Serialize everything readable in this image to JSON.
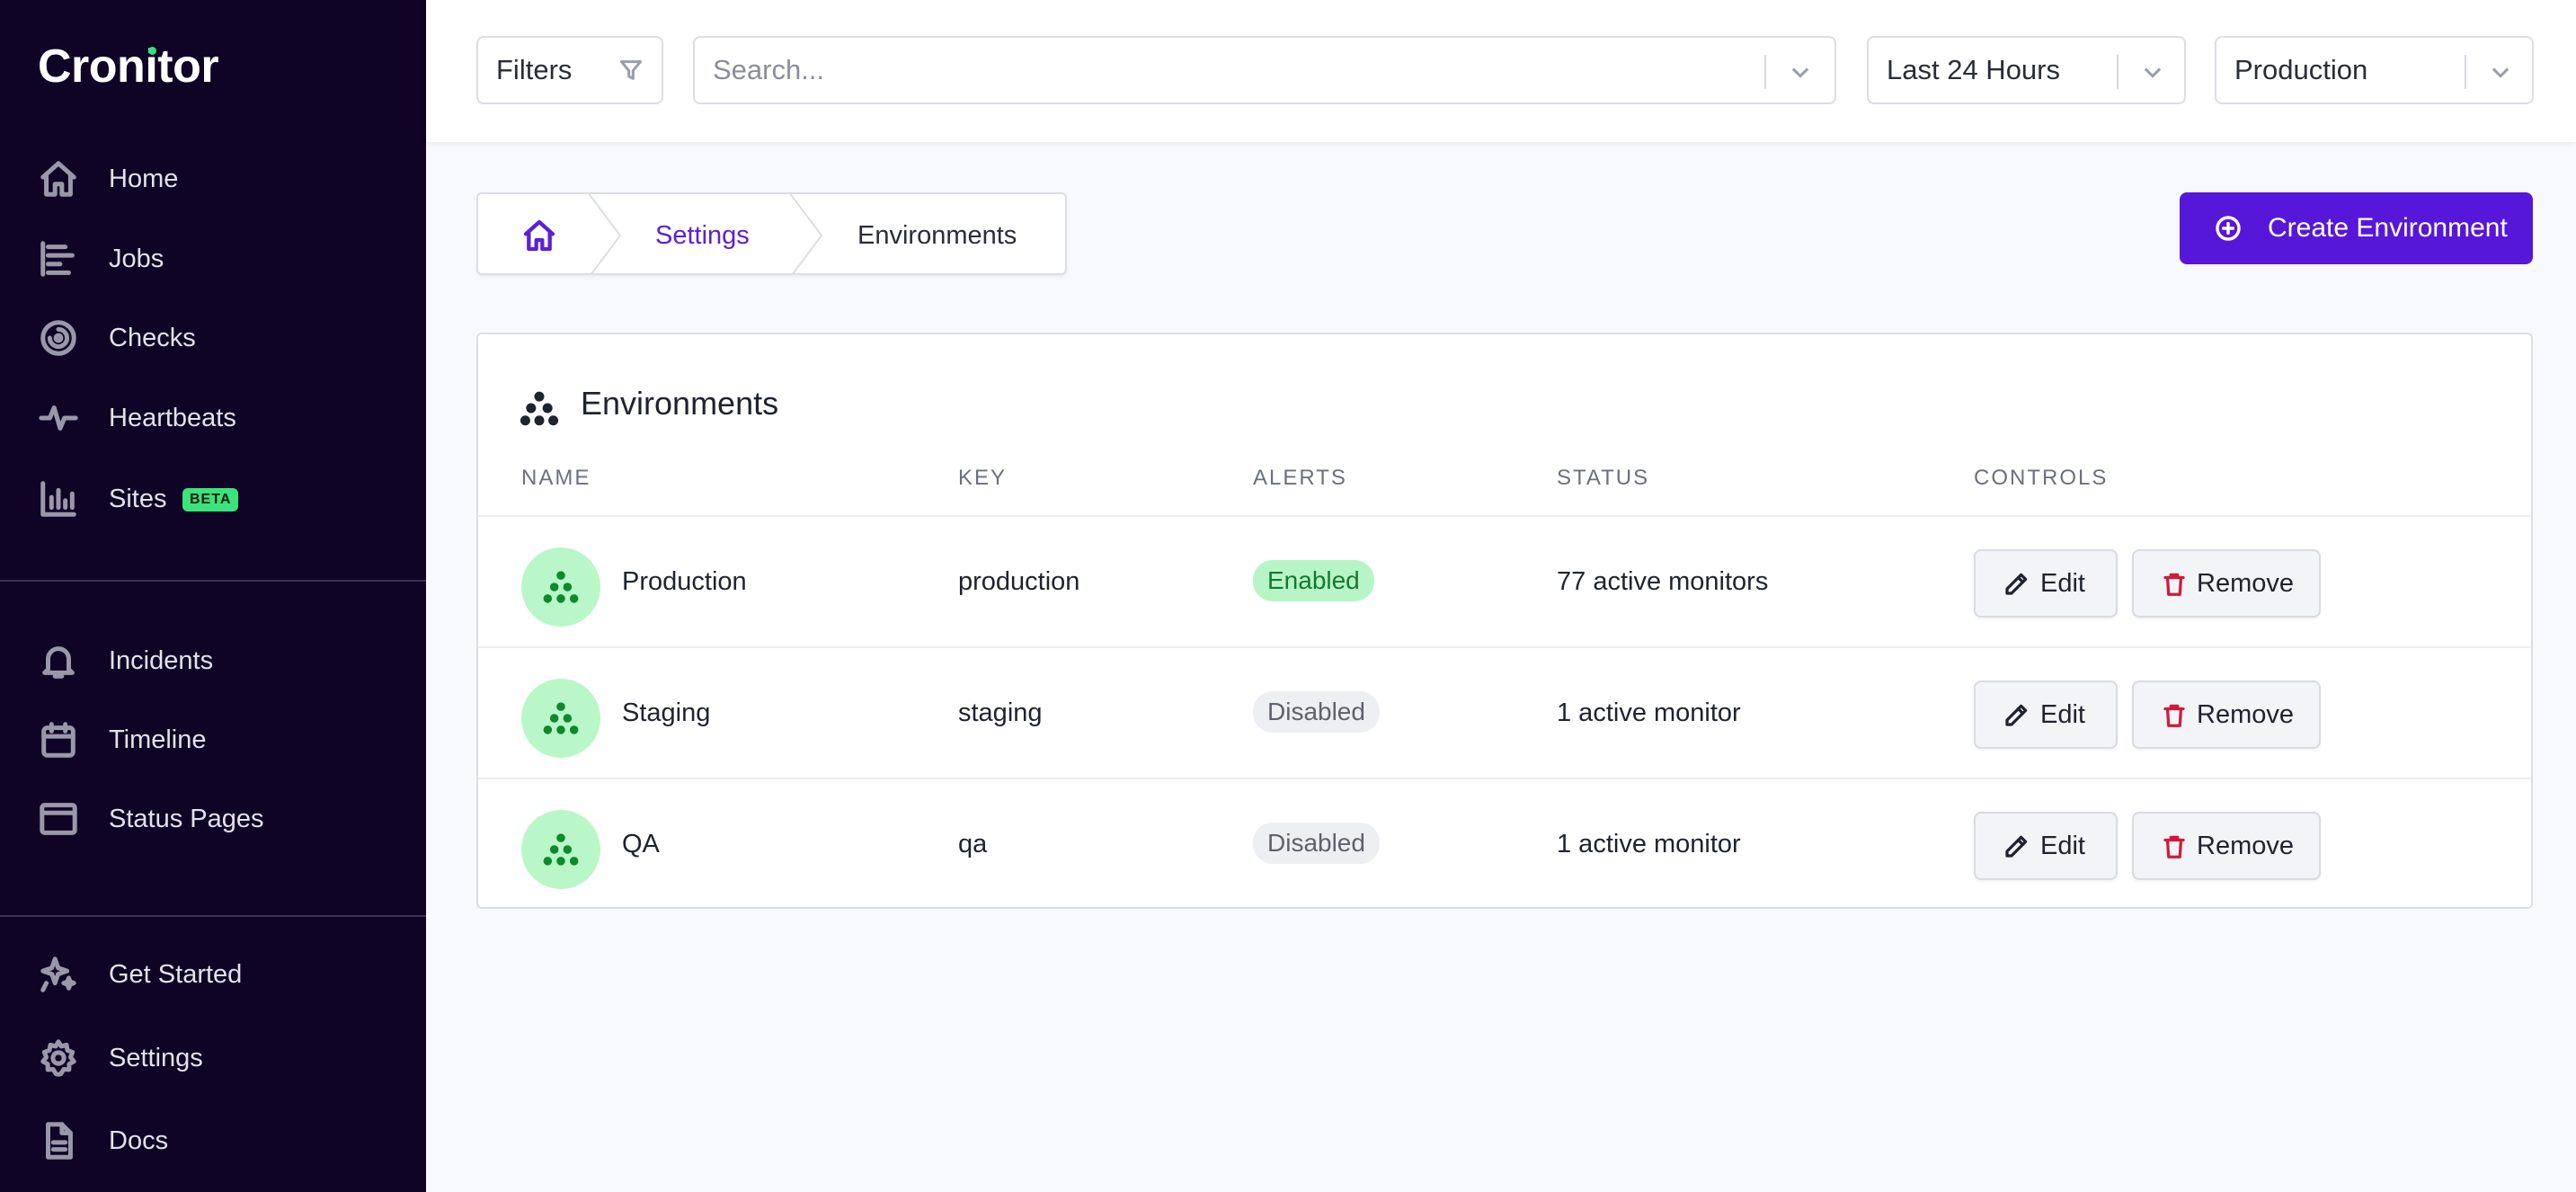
{
  "app": {
    "name": "Cronitor"
  },
  "sidebar": {
    "primary": [
      {
        "label": "Home",
        "icon": "home-icon"
      },
      {
        "label": "Jobs",
        "icon": "jobs-icon"
      },
      {
        "label": "Checks",
        "icon": "checks-icon"
      },
      {
        "label": "Heartbeats",
        "icon": "heartbeat-icon"
      },
      {
        "label": "Sites",
        "icon": "chart-bar-icon",
        "badge": "BETA"
      }
    ],
    "secondary": [
      {
        "label": "Incidents",
        "icon": "bell-icon"
      },
      {
        "label": "Timeline",
        "icon": "calendar-icon"
      },
      {
        "label": "Status Pages",
        "icon": "browser-window-icon"
      }
    ],
    "footer": [
      {
        "label": "Get Started",
        "icon": "sparkles-icon"
      },
      {
        "label": "Settings",
        "icon": "gear-icon"
      },
      {
        "label": "Docs",
        "icon": "document-icon"
      }
    ]
  },
  "topbar": {
    "filters_label": "Filters",
    "search_placeholder": "Search...",
    "time_range": "Last 24 Hours",
    "environment": "Production"
  },
  "breadcrumb": {
    "settings": "Settings",
    "current": "Environments"
  },
  "create_button": "Create Environment",
  "card": {
    "title": "Environments",
    "columns": [
      "NAME",
      "KEY",
      "ALERTS",
      "STATUS",
      "CONTROLS"
    ],
    "rows": [
      {
        "name": "Production",
        "key": "production",
        "alerts": "Enabled",
        "status": "77 active monitors"
      },
      {
        "name": "Staging",
        "key": "staging",
        "alerts": "Disabled",
        "status": "1 active monitor"
      },
      {
        "name": "QA",
        "key": "qa",
        "alerts": "Disabled",
        "status": "1 active monitor"
      }
    ],
    "edit_label": "Edit",
    "remove_label": "Remove"
  },
  "colors": {
    "sidebar_bg": "#0f0426",
    "accent": "#5717d9",
    "enabled_bg": "#b8f5c6",
    "enabled_text": "#127a32",
    "danger": "#d11a3b"
  }
}
